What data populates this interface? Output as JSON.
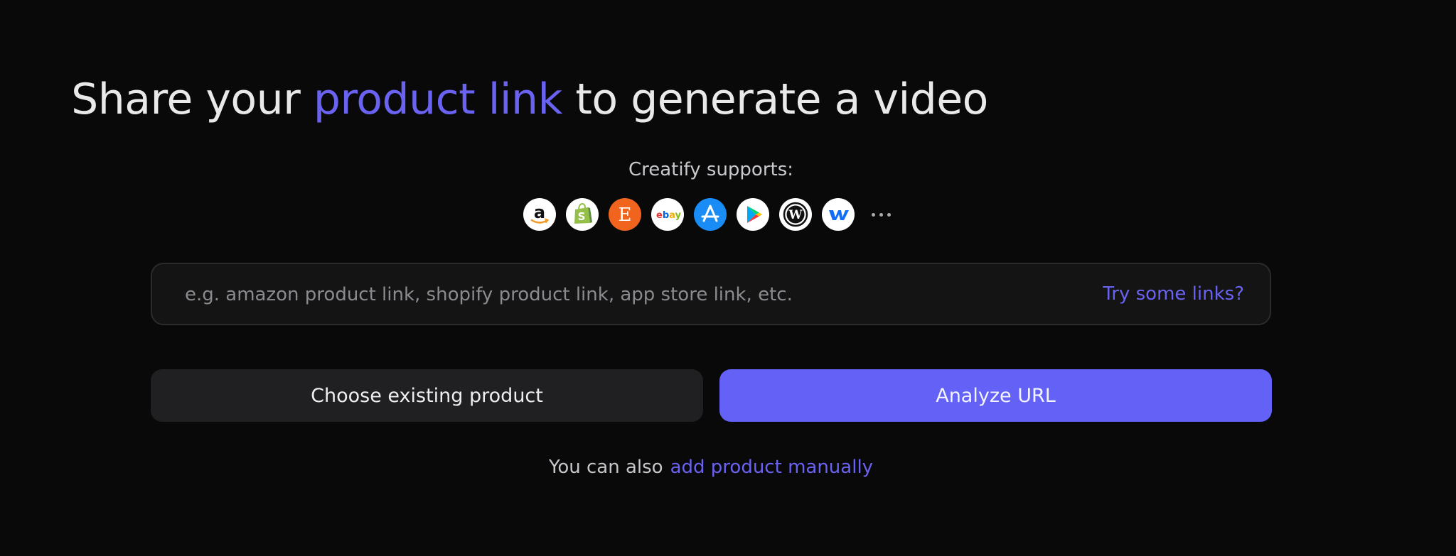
{
  "heading": {
    "prefix": "Share your ",
    "highlight": "product link",
    "suffix": " to generate a video"
  },
  "supports_label": "Creatify supports:",
  "platforms": [
    {
      "icon": "amazon-icon",
      "label": "amazon"
    },
    {
      "icon": "shopify-icon",
      "label": "shopify"
    },
    {
      "icon": "etsy-icon",
      "label": "E"
    },
    {
      "icon": "ebay-icon",
      "label": "ebay"
    },
    {
      "icon": "app-store-icon",
      "label": "app store"
    },
    {
      "icon": "google-play-icon",
      "label": "google play"
    },
    {
      "icon": "wordpress-icon",
      "label": "wordpress"
    },
    {
      "icon": "webflow-icon",
      "label": "webflow"
    },
    {
      "icon": "more-icon",
      "label": "more"
    }
  ],
  "url_input": {
    "placeholder": "e.g. amazon product link, shopify product link, app store link, etc.",
    "value": ""
  },
  "try_links_label": "Try some links?",
  "buttons": {
    "existing": "Choose existing product",
    "analyze": "Analyze URL"
  },
  "footer": {
    "prefix": "You can also",
    "link": "add product manually"
  },
  "colors": {
    "accent": "#6a62f0",
    "primary_button": "#6361f6",
    "background": "#09090a"
  }
}
